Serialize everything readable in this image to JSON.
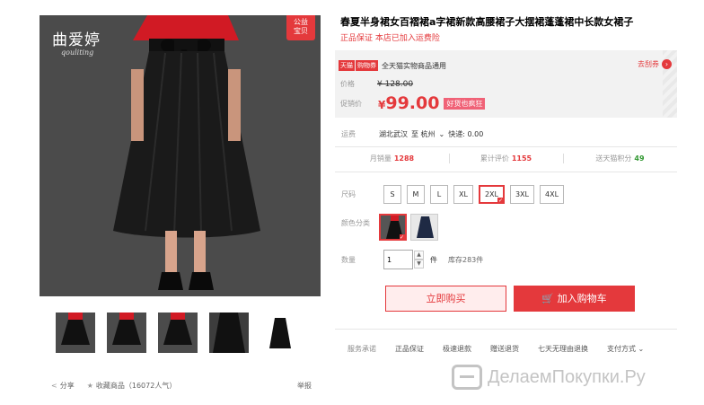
{
  "gallery": {
    "brand_cn": "曲爱婷",
    "brand_en": "qouliting",
    "charity_badge_l1": "公益",
    "charity_badge_l2": "宝贝",
    "thumbnail_count": 5
  },
  "share": {
    "share_label": "分享",
    "favorite_label": "收藏商品",
    "favorite_count": "（16072人气）",
    "report_label": "举报"
  },
  "product": {
    "title": "春夏半身裙女百褶裙a字裙新款高腰裙子大摆裙蓬蓬裙中长款女裙子",
    "subtitle": "正品保证 本店已加入运费险"
  },
  "price": {
    "tag_tmall": "天猫",
    "tag_shop": "购物券",
    "promo_text": "全天猫实物商品通用",
    "coupon_label": "去刮券",
    "orig_label": "价格",
    "orig_value": "¥ 128.00",
    "sale_label": "促销价",
    "sale_currency": "¥",
    "sale_value": "99.00",
    "sale_tag": "好货也疯狂"
  },
  "shipping": {
    "label": "运费",
    "from": "湖北武汉",
    "to": "至 杭州",
    "detail": "快递: 0.00"
  },
  "stats": {
    "monthly_label": "月销量",
    "monthly_value": "1288",
    "reviews_label": "累计评价",
    "reviews_value": "1155",
    "points_label": "送天猫积分",
    "points_value": "49"
  },
  "options": {
    "size_label": "尺码",
    "sizes": [
      "S",
      "M",
      "L",
      "XL",
      "2XL",
      "3XL",
      "4XL"
    ],
    "selected_size": "2XL",
    "color_label": "颜色分类",
    "qty_label": "数量",
    "qty_value": "1",
    "qty_unit": "件",
    "stock": "库存283件"
  },
  "actions": {
    "buy_now": "立即购买",
    "add_to_cart": "加入购物车"
  },
  "services": {
    "label": "服务承诺",
    "items": [
      "正品保证",
      "极速退款",
      "赠送退货",
      "七天无理由退换",
      "支付方式 ⌄"
    ]
  },
  "watermark": {
    "text": "ДелаемПокупки.Ру"
  },
  "colors": {
    "accent": "#e4393c",
    "photo_bg": "#4b4b4b"
  }
}
